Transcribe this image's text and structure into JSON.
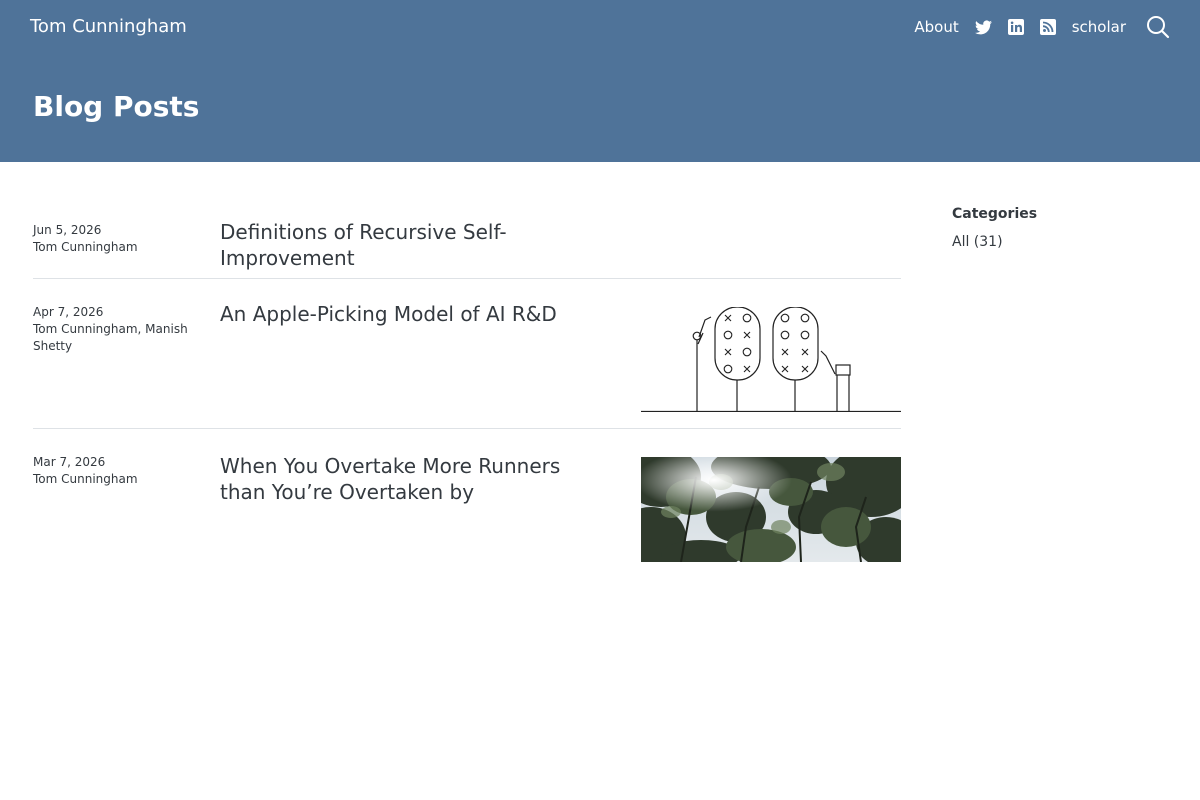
{
  "header": {
    "brand": "Tom Cunningham",
    "nav": {
      "about": "About",
      "scholar": "scholar"
    },
    "page_title": "Blog Posts",
    "background_color": "#4f7399"
  },
  "posts": [
    {
      "date": "Jun 5, 2026",
      "authors": "Tom Cunningham",
      "title": "Definitions of Recursive Self-Improvement",
      "thumbnail": ""
    },
    {
      "date": "Apr 7, 2026",
      "authors": "Tom Cunningham, Manish Shetty",
      "title": "An Apple-Picking Model of AI R&D",
      "thumbnail": "apple-trees-line-drawing"
    },
    {
      "date": "Mar 7, 2026",
      "authors": "Tom Cunningham",
      "title": "When You Overtake More Runners than You’re Overtaken by",
      "thumbnail": "forest-canopy-photo"
    }
  ],
  "sidebar": {
    "title": "Categories",
    "categories": [
      {
        "label": "All (31)"
      }
    ]
  }
}
